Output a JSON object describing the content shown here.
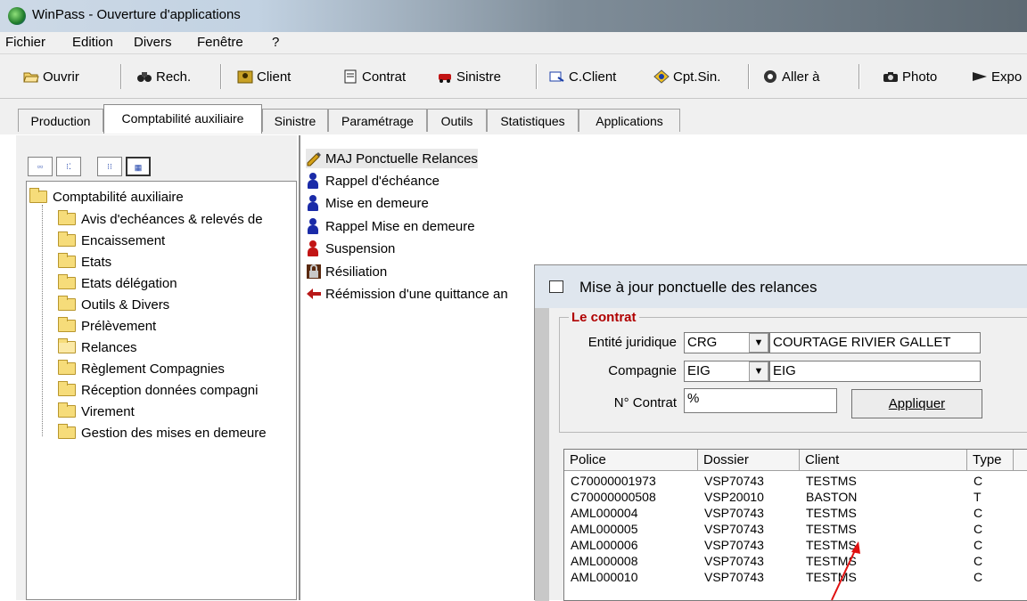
{
  "window": {
    "title": "WinPass - Ouverture d'applications"
  },
  "menu": [
    "Fichier",
    "Edition",
    "Divers",
    "Fenêtre",
    "?"
  ],
  "toolbar": {
    "ouvrir": "Ouvrir",
    "rech": "Rech.",
    "client": "Client",
    "contrat": "Contrat",
    "sinistre": "Sinistre",
    "cclient": "C.Client",
    "cptsin": "Cpt.Sin.",
    "allera": "Aller à",
    "photo": "Photo",
    "export": "Expo"
  },
  "tabs": [
    "Production",
    "Comptabilité auxiliaire",
    "Sinistre",
    "Paramétrage",
    "Outils",
    "Statistiques",
    "Applications"
  ],
  "tree": {
    "root": "Comptabilité auxiliaire",
    "items": [
      "Avis d'echéances & relevés de",
      "Encaissement",
      "Etats",
      "Etats délégation",
      "Outils & Divers",
      "Prélèvement",
      "Relances",
      "Règlement Compagnies",
      "Réception données compagni",
      "Virement",
      "Gestion des mises en demeure"
    ]
  },
  "list": [
    "MAJ Ponctuelle Relances",
    "Rappel d'échéance",
    "Mise en demeure",
    "Rappel Mise en demeure",
    "Suspension",
    "Résiliation",
    "Réémission d'une quittance an"
  ],
  "dialog": {
    "title": "Mise à jour ponctuelle des relances",
    "group_label": "Le contrat",
    "entite_label": "Entité juridique",
    "entite_code": "CRG",
    "entite_name": "COURTAGE RIVIER GALLET",
    "compagnie_label": "Compagnie",
    "compagnie_code": "EIG",
    "compagnie_name": "EIG",
    "contrat_label": "N° Contrat",
    "contrat_value": "%",
    "apply": "Appliquer",
    "columns": [
      "Police",
      "Dossier",
      "Client",
      "Type"
    ],
    "rows": [
      [
        "C70000001973",
        "VSP70743",
        "TESTMS",
        "C"
      ],
      [
        "C70000000508",
        "VSP20010",
        "BASTON",
        "T"
      ],
      [
        "AML000004",
        "VSP70743",
        "TESTMS",
        "C"
      ],
      [
        "AML000005",
        "VSP70743",
        "TESTMS",
        "C"
      ],
      [
        "AML000006",
        "VSP70743",
        "TESTMS",
        "C"
      ],
      [
        "AML000008",
        "VSP70743",
        "TESTMS",
        "C"
      ],
      [
        "AML000010",
        "VSP70743",
        "TESTMS",
        "C"
      ]
    ]
  }
}
